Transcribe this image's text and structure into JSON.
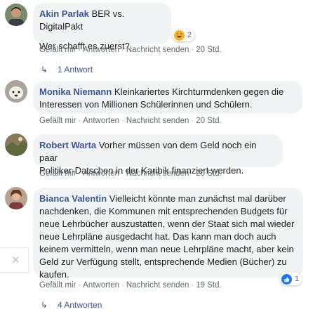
{
  "comments": [
    {
      "author": "Akin Parlak",
      "text_line1": "BER vs. DigitalPakt",
      "text_line2": "Wer schafft es zuerst?",
      "reaction_count": "2",
      "actions": {
        "like": "Gefällt mir",
        "reply": "Antworten",
        "message": "Nachricht senden",
        "time": "20 Std."
      },
      "replies": "1 Antwort"
    },
    {
      "author": "Monika Niemann",
      "text_line1": "Kleinkariertes Kirchturmdenken gegen die",
      "text_line2": "Interessen von Millionen Schülerinnen und Schülern.",
      "actions": {
        "like": "Gefällt mir",
        "reply": "Antworten",
        "message": "Nachricht senden",
        "time": "20 Std."
      }
    },
    {
      "author": "Robert Warta",
      "text_line1": "Vorher müssen von dem Geld noch ein paar",
      "text_line2": "Politiker-Datschen in der Karibik finanziert werden.",
      "actions": {
        "like": "Gefällt mir",
        "reply": "Antworten",
        "message": "Nachricht senden",
        "time": "20 Std."
      }
    },
    {
      "author": "Bianca Valentin",
      "text_line1": "Vielleicht könnte man zunächst mal darüber",
      "text_line2": "nachdenken, die Kommunen mit entsprechenden Budgets für",
      "text_line3": "neue Lehrbücher auszustatten, wenn der Staat sich mal wieder",
      "text_line4": "neue Lehrpläne ausgedacht hat. Das kann man doch auch",
      "text_line5": "keinem vermitteln, wenn man neue Lehrpläne macht, aber kein",
      "text_line6": "Geld zur Verfügung stellt, entsprechende Medien (Bücher) zu",
      "text_line7": "kaufen.",
      "reaction_count": "1",
      "actions": {
        "like": "Gefällt mir",
        "reply": "Antworten",
        "message": "Nachricht senden",
        "time": "19 Std."
      },
      "replies": "4 Antworten"
    }
  ],
  "close_symbol": "✕",
  "reply_arrow": "↳",
  "separator": "·",
  "icons": {
    "haha": "haha-reaction-icon",
    "like": "like-reaction-icon",
    "close": "close-icon"
  },
  "colors": {
    "name": "#385898",
    "bubble": "#f2f3f5",
    "meta": "#8d949e",
    "like_blue": "#1877f2",
    "haha_yellow": "#f7b125"
  }
}
